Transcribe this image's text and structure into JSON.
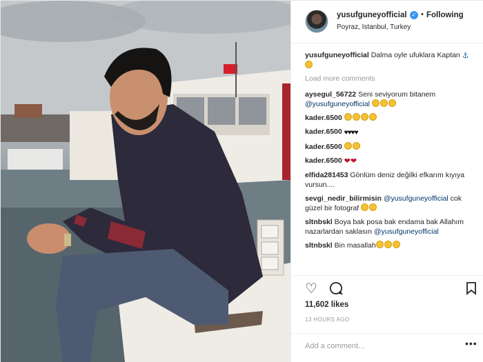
{
  "post": {
    "author": "yusufguneyofficial",
    "follow_label": "Following",
    "location": "Poyraz, Istanbul, Turkey",
    "caption_user": "yusufguneyofficial",
    "caption_text": "Dalma oyle ufuklara Kaptan",
    "load_more": "Load more comments",
    "likes": "11,602 likes",
    "time": "13 HOURS AGO",
    "add_comment_placeholder": "Add a comment...",
    "more_icon": "ellipsis-icon"
  },
  "comments": [
    {
      "user": "aysegul_56722",
      "text": "Seni seviyorum bitanem",
      "mention": "@yusufguneyofficial"
    },
    {
      "user": "kader.6500",
      "text": ""
    },
    {
      "user": "kader.6500",
      "text": ""
    },
    {
      "user": "kader.6500",
      "text": ""
    },
    {
      "user": "kader.6500",
      "text": ""
    },
    {
      "user": "elfida281453",
      "text": "Gönlüm deniz değilki efkarım kıyıya vursun...."
    },
    {
      "user": "sevgi_nedir_bilirmisin",
      "mention": "@yusufguneyofficial",
      "text": "cok güzel bir fotograf"
    },
    {
      "user": "sltnbskl",
      "text": "Boya bak posa bak endama bak Allahım nazarlardan saklasın",
      "mention": "@yusufguneyofficial"
    },
    {
      "user": "sltnbskl",
      "text": "Bin masallah"
    }
  ],
  "icons": {
    "verified": "verified-badge-icon",
    "like": "heart-icon",
    "comment": "comment-icon",
    "save": "bookmark-icon"
  },
  "colors": {
    "link": "#003569",
    "verified": "#3897f0",
    "muted": "#999999",
    "text": "#262626"
  }
}
